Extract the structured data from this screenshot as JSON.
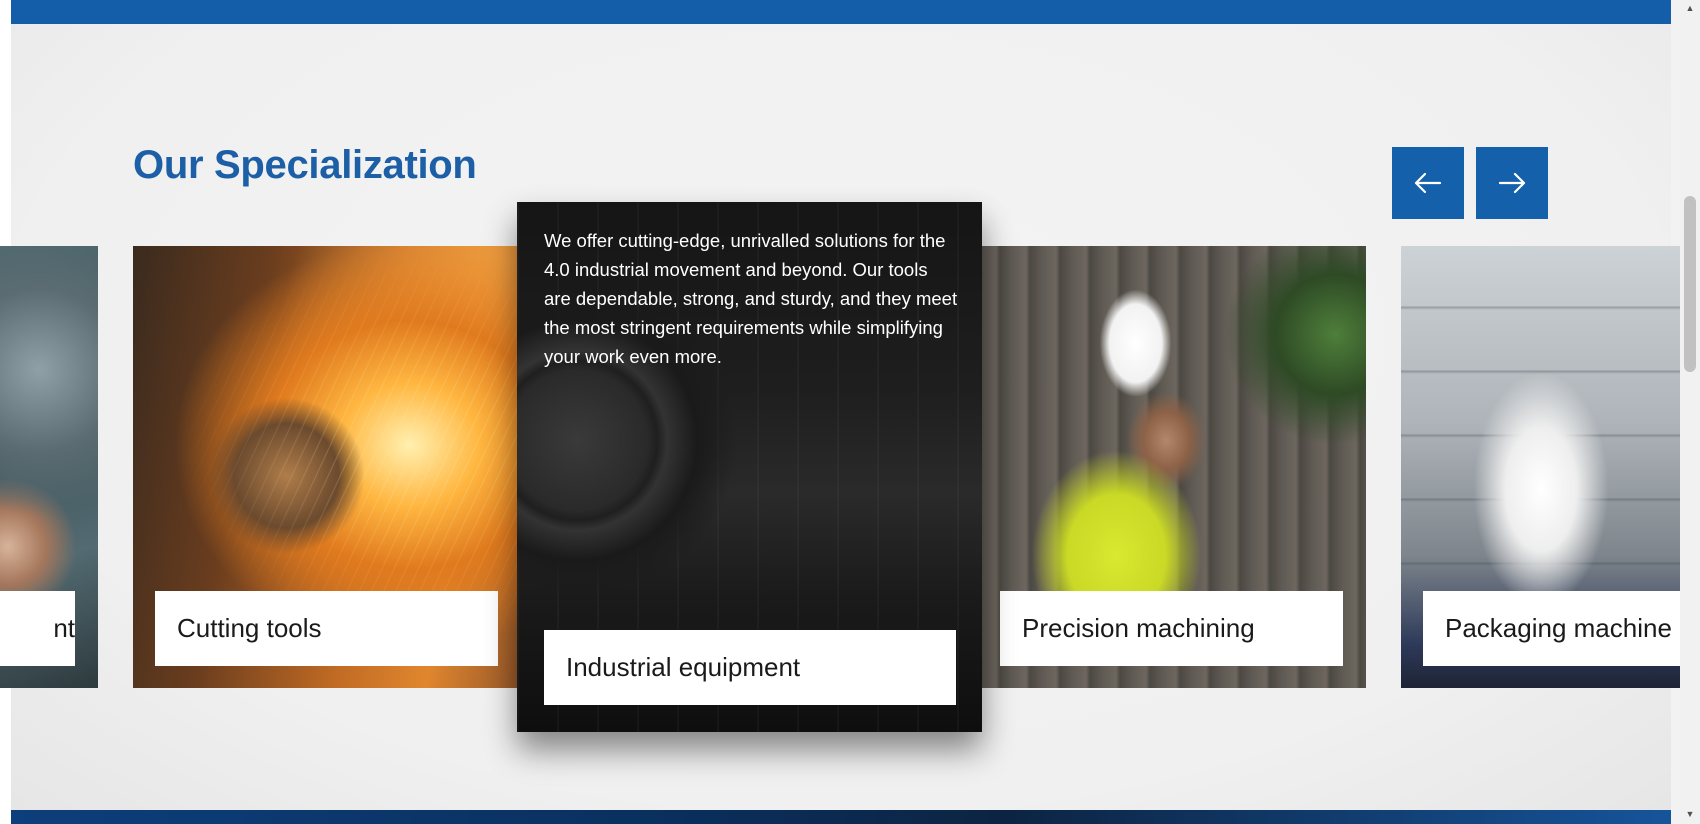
{
  "section": {
    "title": "Our Specialization"
  },
  "nav": {
    "prev_icon": "arrow-left-icon",
    "next_icon": "arrow-right-icon"
  },
  "cards": [
    {
      "label": "nt",
      "image": "metal-lathe-photo"
    },
    {
      "label": "Cutting tools",
      "image": "angle-grinder-sparks-photo"
    },
    {
      "label": "Industrial equipment",
      "image": "dark-industrial-machinery-photo",
      "description": "We offer cutting-edge, unrivalled solutions for the 4.0 industrial movement and beyond. Our tools are dependable, strong, and sturdy, and they meet the most stringent requirements while simplifying your work even more."
    },
    {
      "label": "Precision machining",
      "image": "engineer-hardhat-machine-photo"
    },
    {
      "label": "Packaging machine",
      "image": "packaging-conveyor-photo"
    }
  ],
  "colors": {
    "brand_blue": "#1560ab",
    "title_blue": "#1c5fa6"
  }
}
